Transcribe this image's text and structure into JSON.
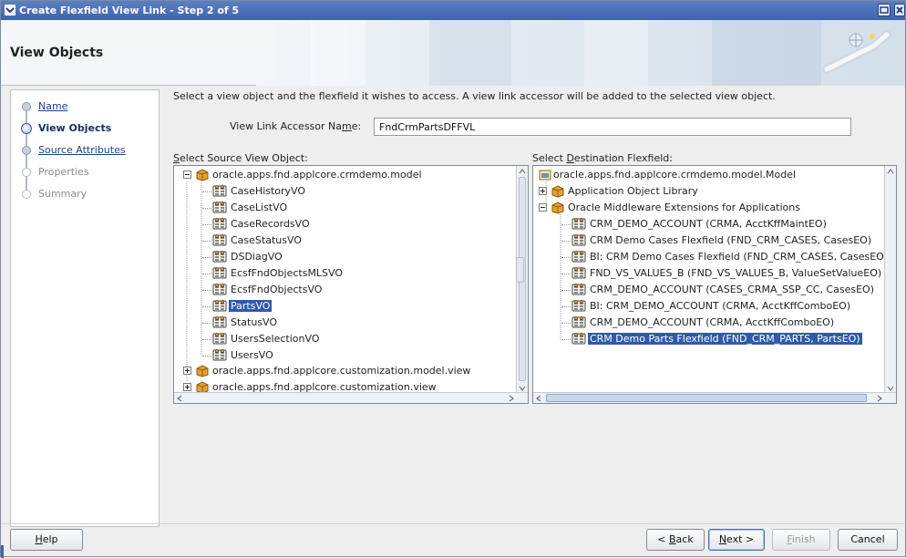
{
  "window": {
    "title": "Create Flexfield View Link - Step 2 of 5"
  },
  "header": {
    "title": "View Objects"
  },
  "steps": [
    {
      "label": "Name",
      "state": "link"
    },
    {
      "label": "View Objects",
      "state": "active"
    },
    {
      "label": "Source Attributes",
      "state": "link"
    },
    {
      "label": "Properties",
      "state": "disabled"
    },
    {
      "label": "Summary",
      "state": "disabled"
    }
  ],
  "main": {
    "instruction": "Select a view object and the flexfield it wishes to access. A view link accessor will be added to the selected view object.",
    "accessor_label_pre": "View Link Accessor Na",
    "accessor_label_mn": "m",
    "accessor_label_post": "e:",
    "accessor_value": "FndCrmPartsDFFVL",
    "source_label_mn": "S",
    "source_label_rest": "elect Source View Object:",
    "dest_label_pre": "Select ",
    "dest_label_mn": "D",
    "dest_label_rest": "estination Flexfield:"
  },
  "source_tree": {
    "root": "oracle.apps.fnd.applcore.crmdemo.model",
    "children": [
      "CaseHistoryVO",
      "CaseListVO",
      "CaseRecordsVO",
      "CaseStatusVO",
      "DSDiagVO",
      "EcsfFndObjectsMLSVO",
      "EcsfFndObjectsVO",
      "PartsVO",
      "StatusVO",
      "UsersSelectionVO",
      "UsersVO"
    ],
    "selected": "PartsVO",
    "others": [
      "oracle.apps.fnd.applcore.customization.model.view",
      "oracle.apps.fnd.applcore.customization.view"
    ]
  },
  "dest_tree": {
    "root": "oracle.apps.fnd.applcore.crmdemo.model.Model",
    "groups": [
      "Application Object Library",
      "Oracle Middleware Extensions for Applications"
    ],
    "children": [
      "CRM_DEMO_ACCOUNT (CRMA, AcctKffMaintEO)",
      "CRM Demo Cases Flexfield (FND_CRM_CASES, CasesEO)",
      "BI: CRM Demo Cases Flexfield (FND_CRM_CASES, CasesEO)",
      "FND_VS_VALUES_B (FND_VS_VALUES_B, ValueSetValueEO)",
      "CRM_DEMO_ACCOUNT (CASES_CRMA_SSP_CC, CasesEO)",
      "BI: CRM_DEMO_ACCOUNT (CRMA, AcctKffComboEO)",
      "CRM_DEMO_ACCOUNT (CRMA, AcctKffComboEO)",
      "CRM Demo Parts Flexfield (FND_CRM_PARTS, PartsEO)"
    ],
    "selected": "CRM Demo Parts Flexfield (FND_CRM_PARTS, PartsEO)"
  },
  "buttons": {
    "help_mn": "H",
    "help_rest": "elp",
    "back_pre": "< ",
    "back_mn": "B",
    "back_rest": "ack",
    "next_mn": "N",
    "next_rest": "ext >",
    "finish_mn": "F",
    "finish_rest": "inish",
    "cancel": "Cancel"
  },
  "colors": {
    "title_bar": "#3d63ad",
    "selection": "#2f5aa8",
    "link": "#1f3f88"
  }
}
